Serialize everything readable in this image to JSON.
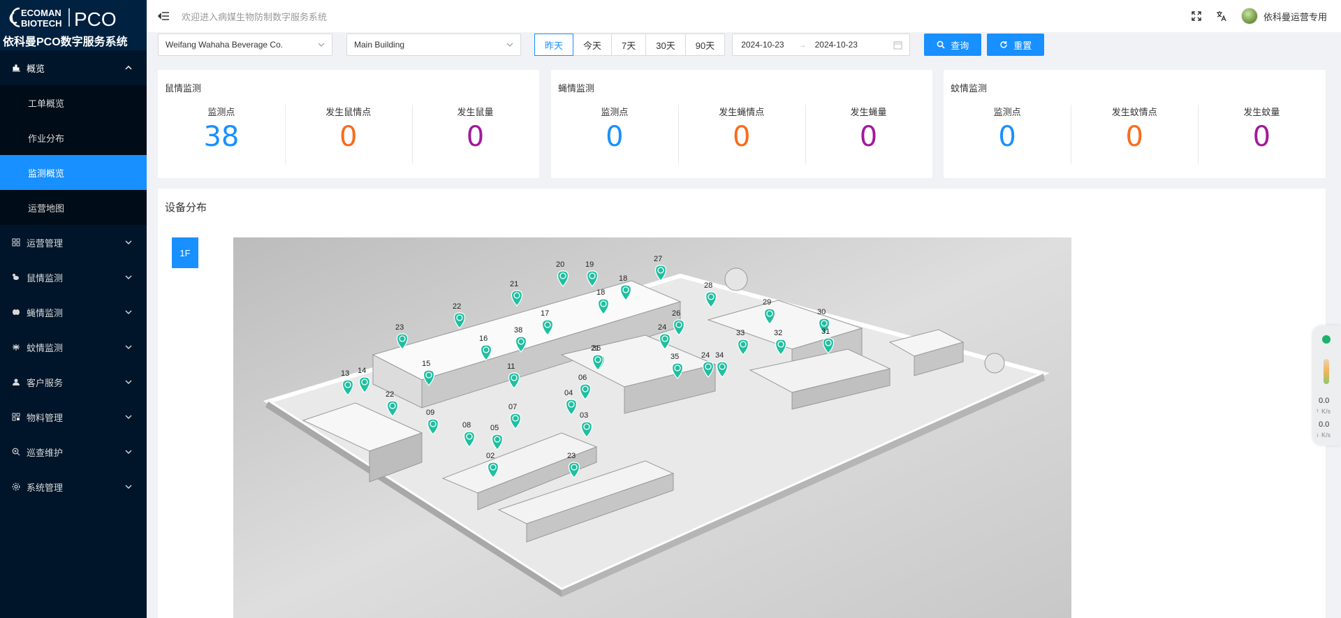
{
  "brand": {
    "logo_line1": "ECOMAN",
    "logo_line2": "BIOTECH",
    "logo_pco": "PCO",
    "system_name": "依科曼PCO数字服务系统"
  },
  "header": {
    "welcome": "欢迎进入病媒生物防制数字服务系统",
    "user_name": "依科曼运营专用"
  },
  "sidebar": {
    "items": [
      {
        "label": "概览",
        "icon": "chart-icon",
        "expanded": true
      },
      {
        "label": "工单概览"
      },
      {
        "label": "作业分布"
      },
      {
        "label": "监测概览",
        "active": true
      },
      {
        "label": "运营地图"
      },
      {
        "label": "运营管理",
        "icon": "grid-icon"
      },
      {
        "label": "鼠情监测",
        "icon": "rat-icon"
      },
      {
        "label": "蝇情监测",
        "icon": "fly-icon"
      },
      {
        "label": "蚊情监测",
        "icon": "mosquito-icon"
      },
      {
        "label": "客户服务",
        "icon": "user-icon"
      },
      {
        "label": "物料管理",
        "icon": "box-icon"
      },
      {
        "label": "巡查维护",
        "icon": "inspect-icon"
      },
      {
        "label": "系统管理",
        "icon": "settings-icon"
      }
    ]
  },
  "filter": {
    "company": "Weifang Wahaha Beverage Co.",
    "building": "Main Building",
    "ranges": [
      "昨天",
      "今天",
      "7天",
      "30天",
      "90天"
    ],
    "selected_range": "昨天",
    "date_start": "2024-10-23",
    "date_end": "2024-10-23",
    "query_label": "查询",
    "reset_label": "重置"
  },
  "cards": [
    {
      "title": "鼠情监测",
      "stats": [
        {
          "label": "监测点",
          "value": "38"
        },
        {
          "label": "发生鼠情点",
          "value": "0"
        },
        {
          "label": "发生鼠量",
          "value": "0"
        }
      ]
    },
    {
      "title": "蝇情监测",
      "stats": [
        {
          "label": "监测点",
          "value": "0"
        },
        {
          "label": "发生蝇情点",
          "value": "0"
        },
        {
          "label": "发生蝇量",
          "value": "0"
        }
      ]
    },
    {
      "title": "蚊情监测",
      "stats": [
        {
          "label": "监测点",
          "value": "0"
        },
        {
          "label": "发生蚊情点",
          "value": "0"
        },
        {
          "label": "发生蚊量",
          "value": "0"
        }
      ]
    }
  ],
  "colors": {
    "primary": "#1890ff",
    "point_blue": "#1890ff",
    "point_orange": "#fa6b1a",
    "point_purple": "#a0199b",
    "marker_teal": "#1fbfa0"
  },
  "device": {
    "title": "设备分布",
    "floor": "1F",
    "markers": [
      "02",
      "03",
      "04",
      "05",
      "06",
      "07",
      "08",
      "09",
      "11",
      "13",
      "14",
      "15",
      "16",
      "17",
      "18",
      "19",
      "20",
      "21",
      "22",
      "23",
      "24",
      "26",
      "27",
      "28",
      "29",
      "30",
      "31",
      "32",
      "33",
      "34",
      "35",
      "36",
      "38",
      "18",
      "21",
      "22",
      "23",
      "24"
    ]
  },
  "speed": {
    "up": "0.0",
    "up_unit": "K/s",
    "down": "0.0",
    "down_unit": "K/s"
  }
}
